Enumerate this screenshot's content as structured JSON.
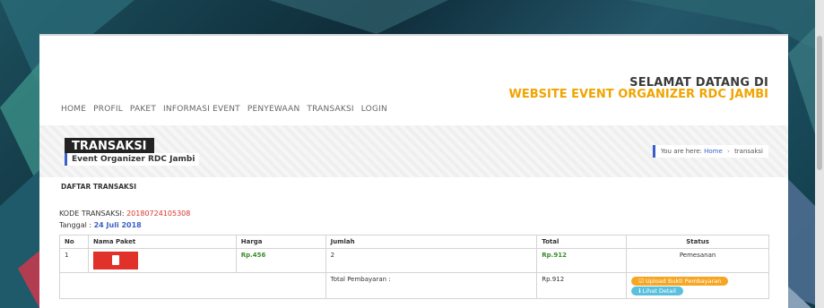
{
  "header": {
    "welcome_line1": "SELAMAT DATANG DI",
    "welcome_line2": "WEBSITE EVENT ORGANIZER RDC JAMBI"
  },
  "nav": {
    "items": [
      "HOME",
      "PROFIL",
      "PAKET",
      "INFORMASI EVENT",
      "PENYEWAAN",
      "TRANSAKSI",
      "LOGIN"
    ]
  },
  "title_band": {
    "title": "TRANSAKSI",
    "subtitle": "Event Organizer RDC Jambi",
    "breadcrumb_prefix": "You are here:",
    "breadcrumb_home": "Home",
    "breadcrumb_sep": "›",
    "breadcrumb_current": "transaksi"
  },
  "content": {
    "section_title": "DAFTAR TRANSAKSI",
    "kode_label": "KODE TRANSAKSI:",
    "kode_value": "20180724105308",
    "tanggal_label": "Tanggal :",
    "tanggal_value": "24 Juli 2018"
  },
  "table": {
    "headers": {
      "no": "No",
      "nama_paket": "Nama Paket",
      "harga": "Harga",
      "jumlah": "Jumlah",
      "total": "Total",
      "status": "Status"
    },
    "row": {
      "no": "1",
      "harga": "Rp.456",
      "jumlah": "2",
      "total": "Rp.912",
      "status": "Pemesanan"
    },
    "footer": {
      "label": "Total Pembayaran :",
      "total": "Rp.912",
      "upload_button": "☑ Upload Bukti Pembayaran",
      "detail_button": "ℹ Lihat Detail"
    }
  },
  "colors": {
    "accent_orange": "#f0a400",
    "accent_blue": "#3a5fc8",
    "code_red": "#d9342b",
    "price_green": "#3a8a2a"
  },
  "icons": {
    "package_image": "paket-thumbnail-icon"
  }
}
